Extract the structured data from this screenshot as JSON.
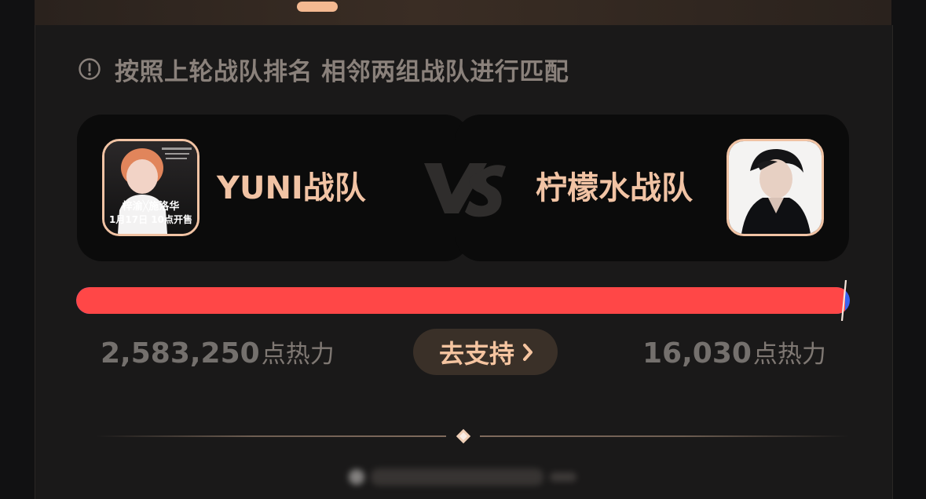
{
  "notice": {
    "icon": "info-circle-icon",
    "text": "按照上轮战队排名 相邻两组战队进行匹配"
  },
  "matchup": {
    "left_team": {
      "name": "YUNI战队",
      "avatar_text": [
        "梓渝╳施洛华",
        "1月17日 10点开售"
      ]
    },
    "right_team": {
      "name": "柠檬水战队"
    },
    "vs_icon": "vs-icon"
  },
  "progress": {
    "left_share": 0.9938,
    "left_color": "#ff4747",
    "right_color": "#3b63ee"
  },
  "scores": {
    "left_value": "2,583,250",
    "left_unit": "点热力",
    "right_value": "16,030",
    "right_unit": "点热力"
  },
  "support_button": {
    "label": "去支持",
    "icon": "chevron-right-icon"
  },
  "divider": {
    "icon": "diamond-icon"
  },
  "colors": {
    "accent": "#f1c3a4",
    "panel": "#1a1919",
    "button": "#3a3028"
  }
}
